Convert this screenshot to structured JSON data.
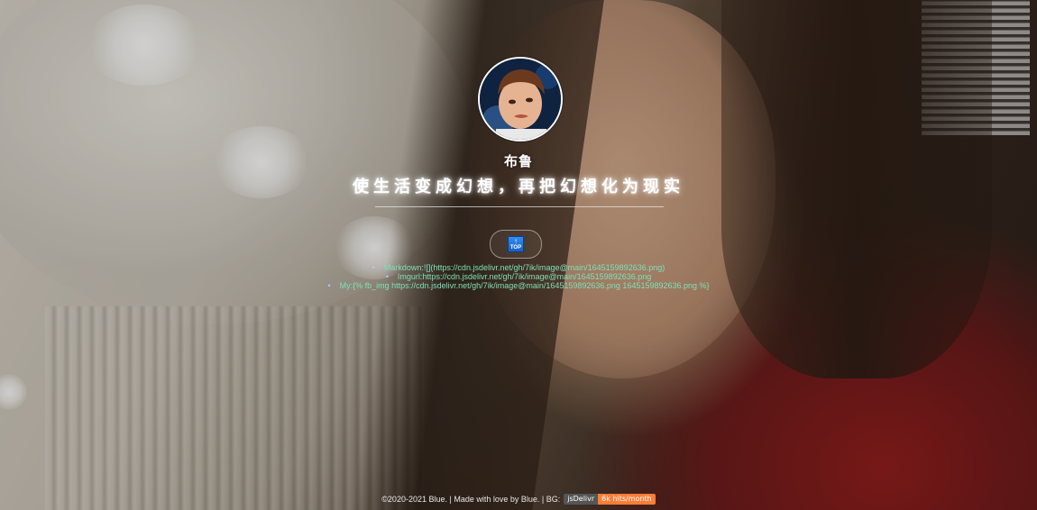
{
  "profile": {
    "name": "布鲁",
    "motto": "使生活变成幻想，再把幻想化为现实"
  },
  "top_button": {
    "icon": "back-to-top-icon",
    "label": "TOP"
  },
  "links": [
    "Markdown:![](https://cdn.jsdelivr.net/gh/7ik/image@main/1645159892636.png)",
    "Imgurl:https://cdn.jsdelivr.net/gh/7ik/image@main/1645159892636.png",
    "My:{% fb_img https://cdn.jsdelivr.net/gh/7ik/image@main/1645159892636.png 1645159892636.png %}"
  ],
  "footer": {
    "text": "©2020-2021 Blue. | Made with love by Blue. | BG:",
    "badge_left": "jsDelivr",
    "badge_right": "6k hits/month",
    "badge_right_color": "#fe7d37"
  },
  "colors": {
    "link_text": "#7fe0b8",
    "text": "#ffffff"
  }
}
